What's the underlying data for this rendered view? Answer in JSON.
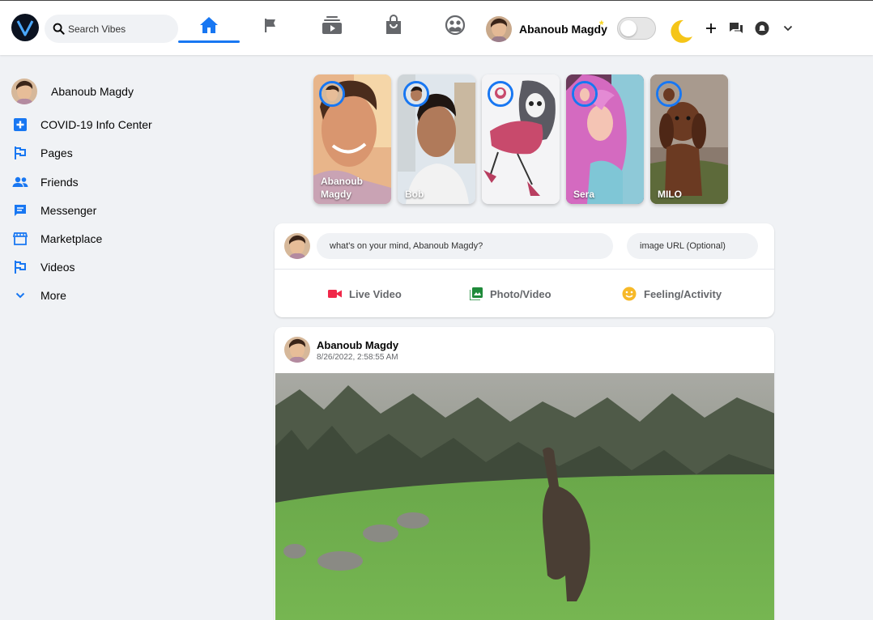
{
  "header": {
    "search_placeholder": "Search Vibes",
    "user_name": "Abanoub Magdy",
    "spark": "*",
    "nav_tabs": [
      "home",
      "pages",
      "watch",
      "marketplace",
      "groups"
    ]
  },
  "sidebar": {
    "profile_name": "Abanoub Magdy",
    "items": [
      {
        "label": "COVID-19 Info Center",
        "icon": "plus-square-icon"
      },
      {
        "label": "Pages",
        "icon": "flag-icon"
      },
      {
        "label": "Friends",
        "icon": "people-icon"
      },
      {
        "label": "Messenger",
        "icon": "chat-icon"
      },
      {
        "label": "Marketplace",
        "icon": "storefront-icon"
      },
      {
        "label": "Videos",
        "icon": "flag-icon"
      },
      {
        "label": "More",
        "icon": "chevron-down-icon"
      }
    ]
  },
  "stories": [
    {
      "name": "Abanoub Magdy"
    },
    {
      "name": "Bob"
    },
    {
      "name": ""
    },
    {
      "name": "Sera"
    },
    {
      "name": "MILO"
    }
  ],
  "composer": {
    "status_placeholder": "what's on your mind, Abanoub Magdy?",
    "image_placeholder": "image URL (Optional)",
    "live_label": "Live Video",
    "photo_label": "Photo/Video",
    "feeling_label": "Feeling/Activity"
  },
  "post": {
    "author": "Abanoub Magdy",
    "timestamp": "8/26/2022, 2:58:55 AM"
  },
  "colors": {
    "accent": "#1877f2",
    "live": "#f02849",
    "photo": "#45bd62",
    "feeling": "#f7b928"
  }
}
